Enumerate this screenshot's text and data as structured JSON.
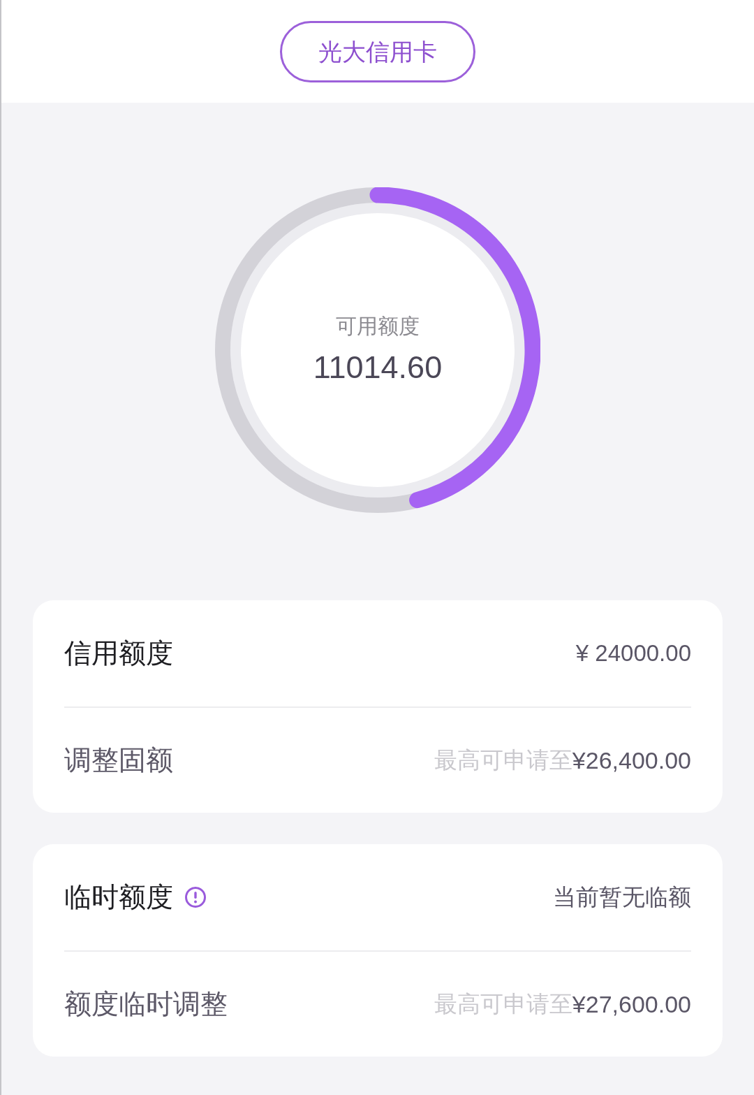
{
  "header": {
    "card_button": "光大信用卡"
  },
  "available": {
    "label": "可用额度",
    "amount": "11014.60",
    "level": 0.459
  },
  "groups": [
    {
      "rows": [
        {
          "kind": "value",
          "label": "信用额度",
          "info": false,
          "value": "¥ 24000.00"
        },
        {
          "kind": "apply",
          "label": "调整固额",
          "info": false,
          "hint": "最高可申请至",
          "amount": "¥26,400.00"
        }
      ]
    },
    {
      "rows": [
        {
          "kind": "value",
          "label": "临时额度",
          "info": true,
          "value": "当前暂无临额"
        },
        {
          "kind": "apply",
          "label": "额度临时调整",
          "info": false,
          "hint": "最高可申请至",
          "amount": "¥27,600.00"
        }
      ]
    }
  ]
}
